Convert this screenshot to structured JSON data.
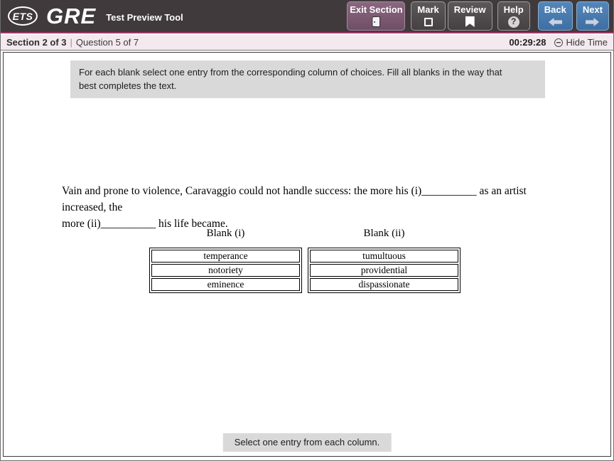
{
  "header": {
    "logo_ets": "ETS",
    "logo_gre": "GRE",
    "app_title": "Test Preview Tool",
    "buttons": {
      "exit_section": "Exit Section",
      "mark": "Mark",
      "review": "Review",
      "help": "Help",
      "back": "Back",
      "next": "Next"
    },
    "help_glyph": "?"
  },
  "status_bar": {
    "section_label": "Section 2 of 3",
    "separator": "|",
    "question_label": "Question 5 of 7",
    "timer": "00:29:28",
    "hide_time_label": "Hide Time"
  },
  "instructions": {
    "line1": "For each blank select one entry from the corresponding column of choices. Fill all blanks in the way that",
    "line2": "best completes the text."
  },
  "question": {
    "line1": "Vain and prone to violence, Caravaggio could not handle success: the more his (i)__________ as an artist increased, the",
    "line2": "more (ii)__________ his life became."
  },
  "blanks": [
    {
      "label": "Blank (i)",
      "choices": [
        "temperance",
        "notoriety",
        "eminence"
      ]
    },
    {
      "label": "Blank (ii)",
      "choices": [
        "tumultuous",
        "providential",
        "dispassionate"
      ]
    }
  ],
  "footer": {
    "prompt": "Select one entry from each column."
  },
  "colors": {
    "header_bg": "#403a3c",
    "header_accent_line": "#9e3766",
    "status_bar_bg": "#f4e9ef",
    "dark_button_bg": "#4a4647",
    "blue_button_bg": "#4578ac",
    "exit_button_bg": "#7b5873",
    "panel_gray": "#d9d9d9"
  }
}
